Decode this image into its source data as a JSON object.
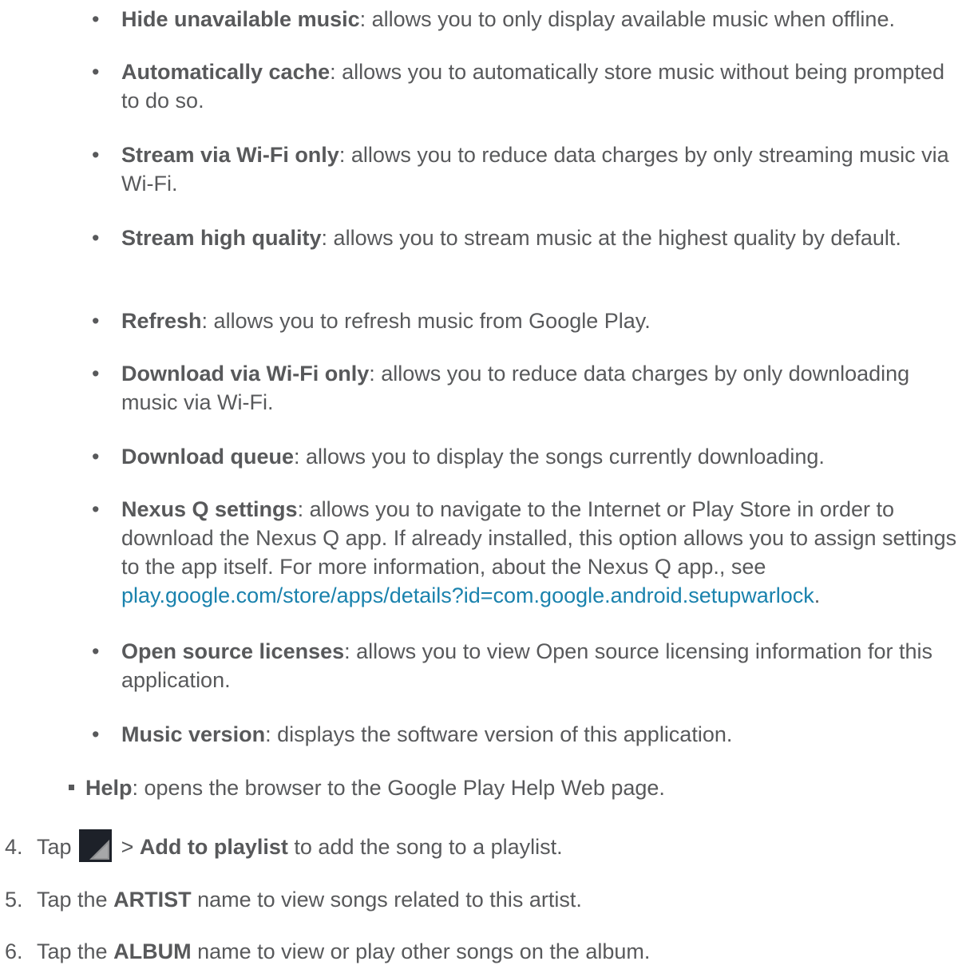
{
  "bullets": [
    {
      "term": "Hide unavailable music",
      "desc": ": allows you to only display available music when offline."
    },
    {
      "term": "Automatically cache",
      "desc": ": allows you to automatically store music without being prompted to do so."
    },
    {
      "term": "Stream via Wi-Fi only",
      "desc": ": allows you to reduce data charges by only streaming music via Wi-Fi."
    },
    {
      "term": "Stream high quality",
      "desc": ": allows you to stream music at the highest quality by default."
    },
    {
      "term": "Refresh",
      "desc": ": allows you to refresh music from Google Play."
    },
    {
      "term": "Download via Wi-Fi only",
      "desc": ": allows you to reduce data charges by only downloading music via Wi-Fi."
    },
    {
      "term": "Download queue",
      "desc": ": allows you to display the songs currently downloading."
    },
    {
      "term": "Nexus Q settings",
      "desc": ": allows you to navigate to the Internet or Play Store in order to download the Nexus Q app. If already installed, this option allows you to assign settings to the app itself. For more information, about the Nexus Q app., see ",
      "link": "play.google.com/store/apps/details?id=com.google.android.setupwarlock",
      "after": "."
    },
    {
      "term": "Open source licenses",
      "desc": ": allows you to view Open source licensing information for this application."
    },
    {
      "term": "Music version",
      "desc": ": displays the software version of this application."
    }
  ],
  "help": {
    "term": "Help",
    "desc": ": opens the browser to the Google Play Help Web page."
  },
  "steps": [
    {
      "num": "4.",
      "pre": "Tap",
      "sep": ">",
      "term": "Add to playlist",
      "post": "to add the song to a playlist."
    },
    {
      "num": "5.",
      "pre": "Tap the",
      "term": "ARTIST",
      "post": "name to view songs related to this artist."
    },
    {
      "num": "6.",
      "pre": "Tap the",
      "term": "ALBUM",
      "post": "name to view or play other songs on the album."
    }
  ],
  "menu_icon_name": "overflow-menu-icon",
  "colors": {
    "text": "#58595b",
    "link": "#1a82ad",
    "icon_bg": "#1d2129"
  }
}
